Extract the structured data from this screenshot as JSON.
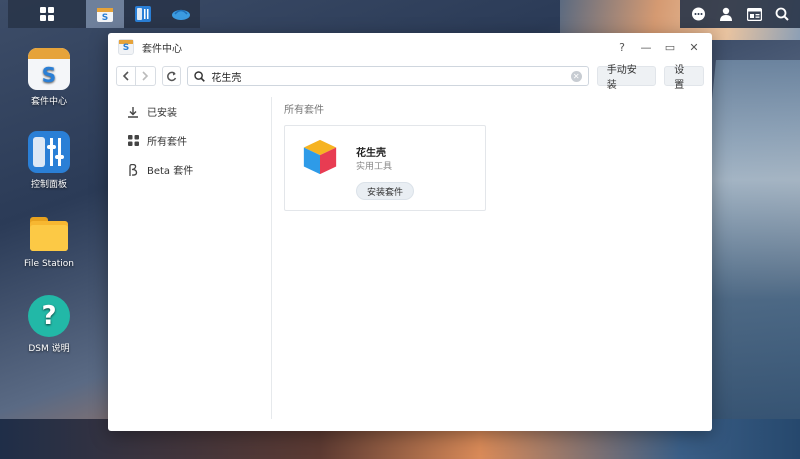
{
  "taskbar": {
    "left_icons": [
      "main-menu-icon",
      "package-center-icon",
      "control-panel-icon",
      "oray-icon"
    ],
    "right_icons": [
      "chat-icon",
      "user-icon",
      "widgets-icon",
      "search-icon"
    ]
  },
  "desktop": {
    "items": [
      {
        "label": "套件中心"
      },
      {
        "label": "控制面板"
      },
      {
        "label": "File Station"
      },
      {
        "label": "DSM 说明"
      }
    ]
  },
  "window": {
    "title": "套件中心",
    "controls": [
      "?",
      "—",
      "▭",
      "✕"
    ],
    "search_value": "花生壳",
    "manual_install_label": "手动安装",
    "settings_label": "设置",
    "sidebar": [
      {
        "label": "已安装"
      },
      {
        "label": "所有套件"
      },
      {
        "label": "Beta 套件"
      }
    ],
    "section_title": "所有套件",
    "package": {
      "name": "花生壳",
      "category": "实用工具",
      "install_label": "安装套件"
    }
  },
  "colors": {
    "accent": "#2a7fd6",
    "window_bg": "#ffffff",
    "taskbar_bg": "#28344a"
  }
}
